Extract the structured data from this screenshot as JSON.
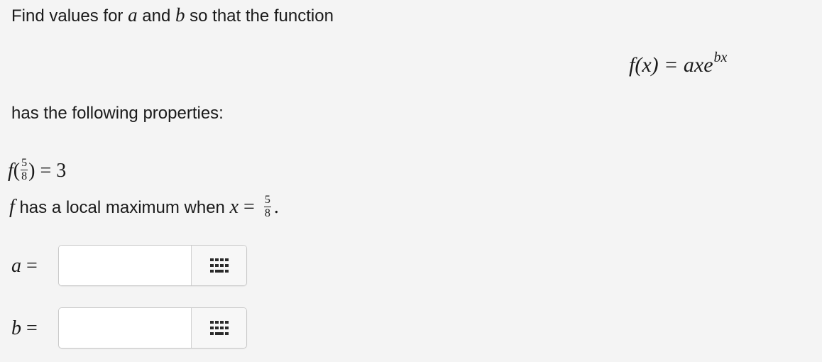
{
  "question": {
    "intro_prefix": "Find values for ",
    "var_a": "a",
    "and": " and ",
    "var_b": "b",
    "intro_suffix": " so that the function",
    "formula": {
      "lhs": "f(x) = ",
      "base": "axe",
      "exponent": "bx"
    },
    "properties_heading": "has the following properties:",
    "property1": {
      "func": "f",
      "open": "(",
      "num": "5",
      "den": "8",
      "close": ")",
      "rhs": " = 3"
    },
    "property2": {
      "func": "f",
      "text": " has a local maximum when ",
      "var": "x",
      "eq": " = ",
      "num": "5",
      "den": "8",
      "end": "."
    }
  },
  "answers": {
    "a": {
      "label": "a",
      "eq": " =",
      "value": "",
      "palette_icon": "keypad-grid-icon"
    },
    "b": {
      "label": "b",
      "eq": " =",
      "value": "",
      "palette_icon": "keypad-grid-icon"
    }
  }
}
